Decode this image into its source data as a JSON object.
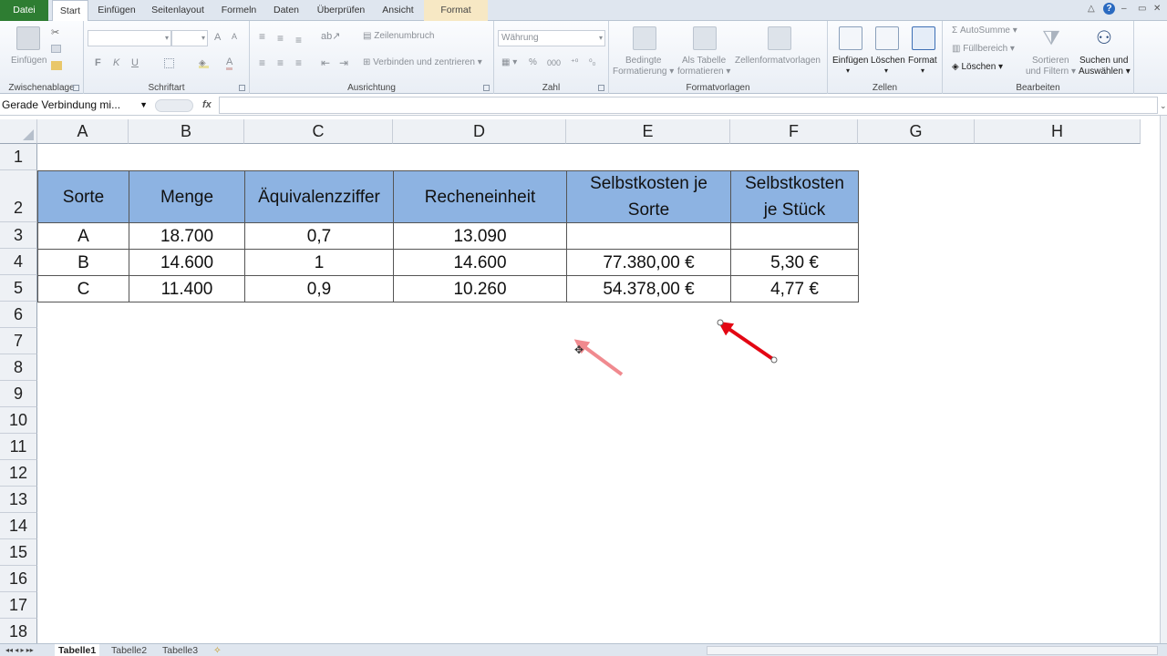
{
  "tabs": {
    "datei": "Datei",
    "start": "Start",
    "einfuegen": "Einfügen",
    "seitenlayout": "Seitenlayout",
    "formeln": "Formeln",
    "daten": "Daten",
    "ueberpruefen": "Überprüfen",
    "ansicht": "Ansicht",
    "format": "Format"
  },
  "ribbon": {
    "clipboard": {
      "paste": "Einfügen",
      "label": "Zwischenablage"
    },
    "font": {
      "bold": "F",
      "italic": "K",
      "underline": "U",
      "grow": "A",
      "label": "Schriftart"
    },
    "alignment": {
      "wrap": "Zeilenumbruch",
      "merge": "Verbinden und zentrieren",
      "label": "Ausrichtung"
    },
    "number": {
      "format": "Währung",
      "percent": "%",
      "thousands": "000",
      "label": "Zahl"
    },
    "styles": {
      "conditional": "Bedingte",
      "conditional2": "Formatierung",
      "table": "Als Tabelle",
      "table2": "formatieren",
      "cellstyles": "Zellenformatvorlagen",
      "label": "Formatvorlagen"
    },
    "cells": {
      "insert": "Einfügen",
      "delete": "Löschen",
      "format": "Format",
      "label": "Zellen"
    },
    "edit": {
      "autosum": "AutoSumme",
      "fill": "Füllbereich",
      "clear": "Löschen",
      "sort": "Sortieren",
      "sort2": "und Filtern",
      "find": "Suchen und",
      "find2": "Auswählen",
      "label": "Bearbeiten"
    }
  },
  "formula": {
    "namebox": "Gerade Verbindung mi...",
    "fx": "fx",
    "content": ""
  },
  "columns": [
    "A",
    "B",
    "C",
    "D",
    "E",
    "F",
    "G",
    "H"
  ],
  "rows": [
    "1",
    "2",
    "3",
    "4",
    "5",
    "6",
    "7",
    "8",
    "9",
    "10",
    "11",
    "12",
    "13",
    "14",
    "15",
    "16",
    "17",
    "18"
  ],
  "table": {
    "headers": [
      "Sorte",
      "Menge",
      "Äquivalenzziffer",
      "Recheneinheit",
      "Selbstkosten je Sorte",
      "Selbstkosten je Stück"
    ],
    "data": [
      [
        "A",
        "18.700",
        "0,7",
        "13.090",
        "",
        ""
      ],
      [
        "B",
        "14.600",
        "1",
        "14.600",
        "77.380,00 €",
        "5,30 €"
      ],
      [
        "C",
        "11.400",
        "0,9",
        "10.260",
        "54.378,00 €",
        "4,77 €"
      ]
    ]
  },
  "header_fill": "#8db3e2",
  "arrow_color": "#e30613",
  "sheets": [
    "Tabelle1",
    "Tabelle2",
    "Tabelle3"
  ]
}
